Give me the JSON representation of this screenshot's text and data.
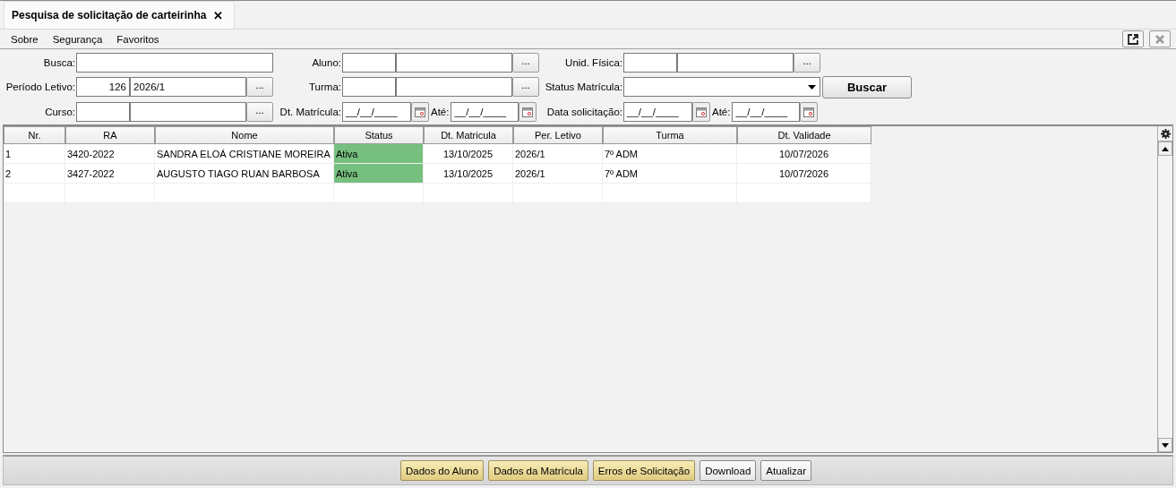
{
  "tab": {
    "title": "Pesquisa de solicitação de carteirinha",
    "close": "✕"
  },
  "menu": [
    {
      "label": "Sobre"
    },
    {
      "label": "Segurança"
    },
    {
      "label": "Favoritos"
    }
  ],
  "window_buttons": [
    {
      "kind": "popout",
      "disabled": false
    },
    {
      "kind": "close",
      "disabled": true
    }
  ],
  "filters": [
    [
      {
        "kind": "text",
        "label": "Busca:"
      },
      {
        "kind": "lookup",
        "label": "Aluno:",
        "button": "..."
      },
      {
        "kind": "lookup",
        "label": "Unid. Física:",
        "button": "..."
      }
    ],
    [
      {
        "kind": "lookup",
        "label": "Período Letivo:",
        "code": "126",
        "name": "2026/1",
        "button": "..."
      },
      {
        "kind": "lookup",
        "label": "Turma:",
        "button": "..."
      },
      {
        "kind": "select",
        "label": "Status Matrícula:"
      }
    ],
    [
      {
        "kind": "lookup",
        "label": "Curso:",
        "button": "..."
      },
      {
        "kind": "daterange",
        "label": "Dt. Matrícula:",
        "from": "__/__/____",
        "to_label": "Até:",
        "to": "__/__/____"
      },
      {
        "kind": "daterange",
        "label": "Data solicitação:",
        "from": "__/__/____",
        "to_label": "Até:",
        "to": "__/__/____"
      }
    ]
  ],
  "search_button": {
    "label": "Buscar"
  },
  "table": {
    "columns": [
      {
        "label": "Nr.",
        "kind": "text"
      },
      {
        "label": "RA",
        "kind": "text"
      },
      {
        "label": "Nome",
        "kind": "text"
      },
      {
        "label": "Status",
        "kind": "status"
      },
      {
        "label": "Dt. Matricula",
        "kind": "date"
      },
      {
        "label": "Per. Letivo",
        "kind": "text"
      },
      {
        "label": "Turma",
        "kind": "text"
      },
      {
        "label": "Dt. Validade",
        "kind": "date"
      }
    ],
    "rows": [
      {
        "cells": [
          "1",
          "3420-2022",
          "SANDRA ELOÁ CRISTIANE MOREIRA",
          "Ativa",
          "13/10/2025",
          "2026/1",
          "7º ADM",
          "10/07/2026"
        ],
        "color": "#77bf7e"
      },
      {
        "cells": [
          "2",
          "3427-2022",
          "AUGUSTO TIAGO RUAN BARBOSA",
          "Ativa",
          "13/10/2025",
          "2026/1",
          "7º ADM",
          "10/07/2026"
        ],
        "color": "#77bf7e"
      }
    ]
  },
  "footer_buttons": [
    {
      "label": "Dados do Aluno",
      "highlighted": true
    },
    {
      "label": "Dados da Matrícula",
      "highlighted": true
    },
    {
      "label": "Erros de Solicitação",
      "highlighted": true
    },
    {
      "label": "Download",
      "highlighted": false
    },
    {
      "label": "Atualizar",
      "highlighted": false
    }
  ]
}
